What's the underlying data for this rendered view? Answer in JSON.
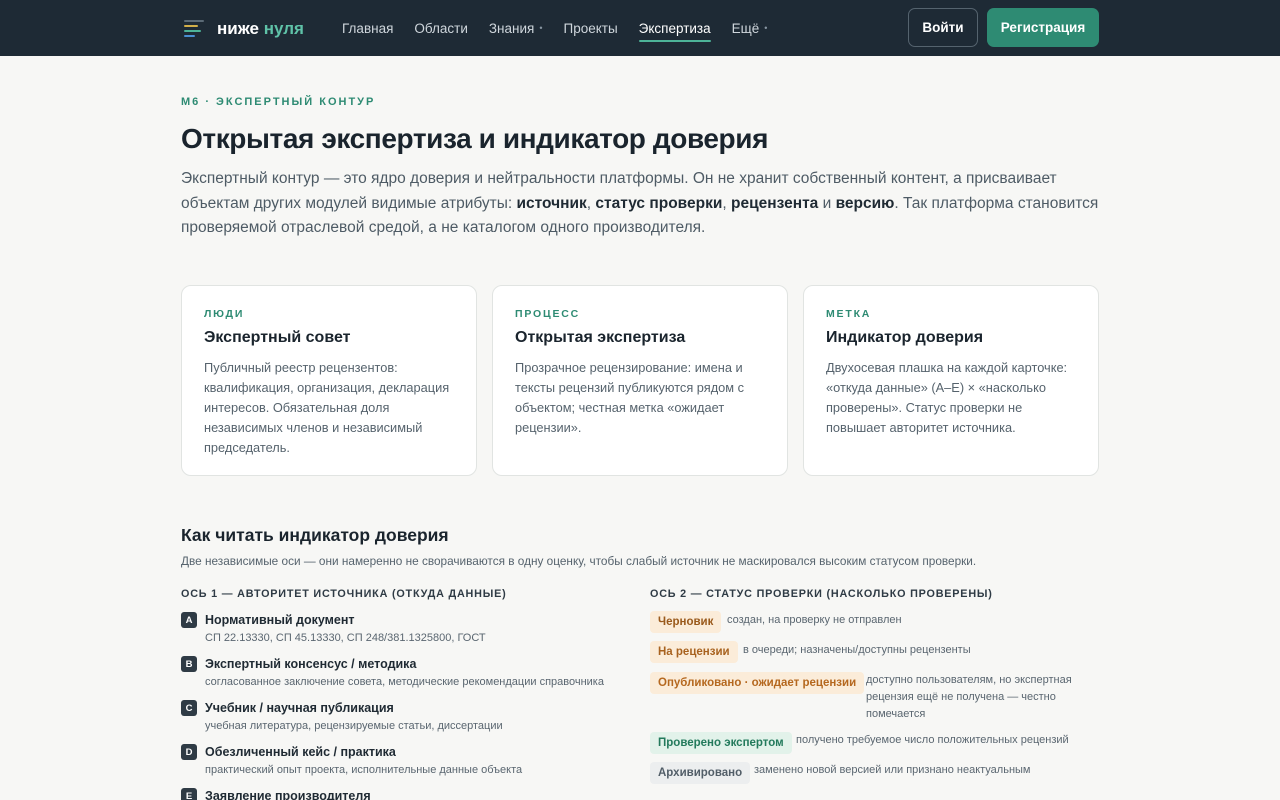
{
  "header": {
    "logo": {
      "word1": "ниже",
      "word2": "нуля"
    },
    "nav": [
      {
        "label": "Главная",
        "dropdown": false,
        "active": false
      },
      {
        "label": "Области",
        "dropdown": false,
        "active": false
      },
      {
        "label": "Знания",
        "dropdown": true,
        "active": false
      },
      {
        "label": "Проекты",
        "dropdown": false,
        "active": false
      },
      {
        "label": "Экспертиза",
        "dropdown": false,
        "active": true
      },
      {
        "label": "Ещё",
        "dropdown": true,
        "active": false
      }
    ],
    "login_label": "Войти",
    "register_label": "Регистрация"
  },
  "hero": {
    "eyebrow": "М6 · ЭКСПЕРТНЫЙ КОНТУР",
    "title": "Открытая экспертиза и индикатор доверия",
    "lead_1": "Экспертный контур — это ядро доверия и нейтральности платформы. Он не хранит собственный контент, а присваивает объектам других модулей видимые атрибуты: ",
    "lead_b1": "источник",
    "lead_s1": ", ",
    "lead_b2": "статус проверки",
    "lead_s2": ", ",
    "lead_b3": "рецензента",
    "lead_s3": " и ",
    "lead_b4": "версию",
    "lead_2": ". Так платформа становится проверяемой отраслевой средой, а не каталогом одного производителя."
  },
  "cards": [
    {
      "eyebrow": "ЛЮДИ",
      "title": "Экспертный совет",
      "text": "Публичный реестр рецензентов: квалификация, организация, декларация интересов. Обязательная доля независимых членов и независимый председатель."
    },
    {
      "eyebrow": "ПРОЦЕСС",
      "title": "Открытая экспертиза",
      "text": "Прозрачное рецензирование: имена и тексты рецензий публикуются рядом с объектом; честная метка «ожидает рецензии»."
    },
    {
      "eyebrow": "МЕТКА",
      "title": "Индикатор доверия",
      "text": "Двухосевая плашка на каждой карточке: «откуда данные» (A–E) × «насколько проверены». Статус проверки не повышает авторитет источника."
    }
  ],
  "indicator": {
    "title": "Как читать индикатор доверия",
    "subtitle": "Две независимые оси — они намеренно не сворачиваются в одну оценку, чтобы слабый источник не маскировался высоким статусом проверки.",
    "axis1": {
      "heading": "ОСЬ 1 — АВТОРИТЕТ ИСТОЧНИКА (ОТКУДА ДАННЫЕ)",
      "items": [
        {
          "letter": "A",
          "title": "Нормативный документ",
          "desc": "СП 22.13330, СП 45.13330, СП 248/381.1325800, ГОСТ"
        },
        {
          "letter": "B",
          "title": "Экспертный консенсус / методика",
          "desc": "согласованное заключение совета, методические рекомендации справочника"
        },
        {
          "letter": "C",
          "title": "Учебник / научная публикация",
          "desc": "учебная литература, рецензируемые статьи, диссертации"
        },
        {
          "letter": "D",
          "title": "Обезличенный кейс / практика",
          "desc": "практический опыт проекта, исполнительные данные объекта"
        },
        {
          "letter": "E",
          "title": "Заявление производителя",
          "desc": ""
        }
      ]
    },
    "axis2": {
      "heading": "ОСЬ 2 — СТАТУС ПРОВЕРКИ (НАСКОЛЬКО ПРОВЕРЕНЫ)",
      "items": [
        {
          "label": "Черновик",
          "desc": "создан, на проверку не отправлен",
          "bg": "#fbecd9",
          "fg": "#9a5a1c"
        },
        {
          "label": "На рецензии",
          "desc": "в очереди; назначены/доступны рецензенты",
          "bg": "#fbecd9",
          "fg": "#a8621f"
        },
        {
          "label": "Опубликовано · ожидает рецензии",
          "desc": "доступно пользователям, но экспертная рецензия ещё не получена — честно помечается",
          "bg": "#fbecd9",
          "fg": "#b5681f"
        },
        {
          "label": "Проверено экспертом",
          "desc": "получено требуемое число положительных рецензий",
          "bg": "#e2f2ea",
          "fg": "#237a5c"
        },
        {
          "label": "Архивировано",
          "desc": "заменено новой версией или признано неактуальным",
          "bg": "#eceeef",
          "fg": "#525e68"
        }
      ]
    }
  }
}
